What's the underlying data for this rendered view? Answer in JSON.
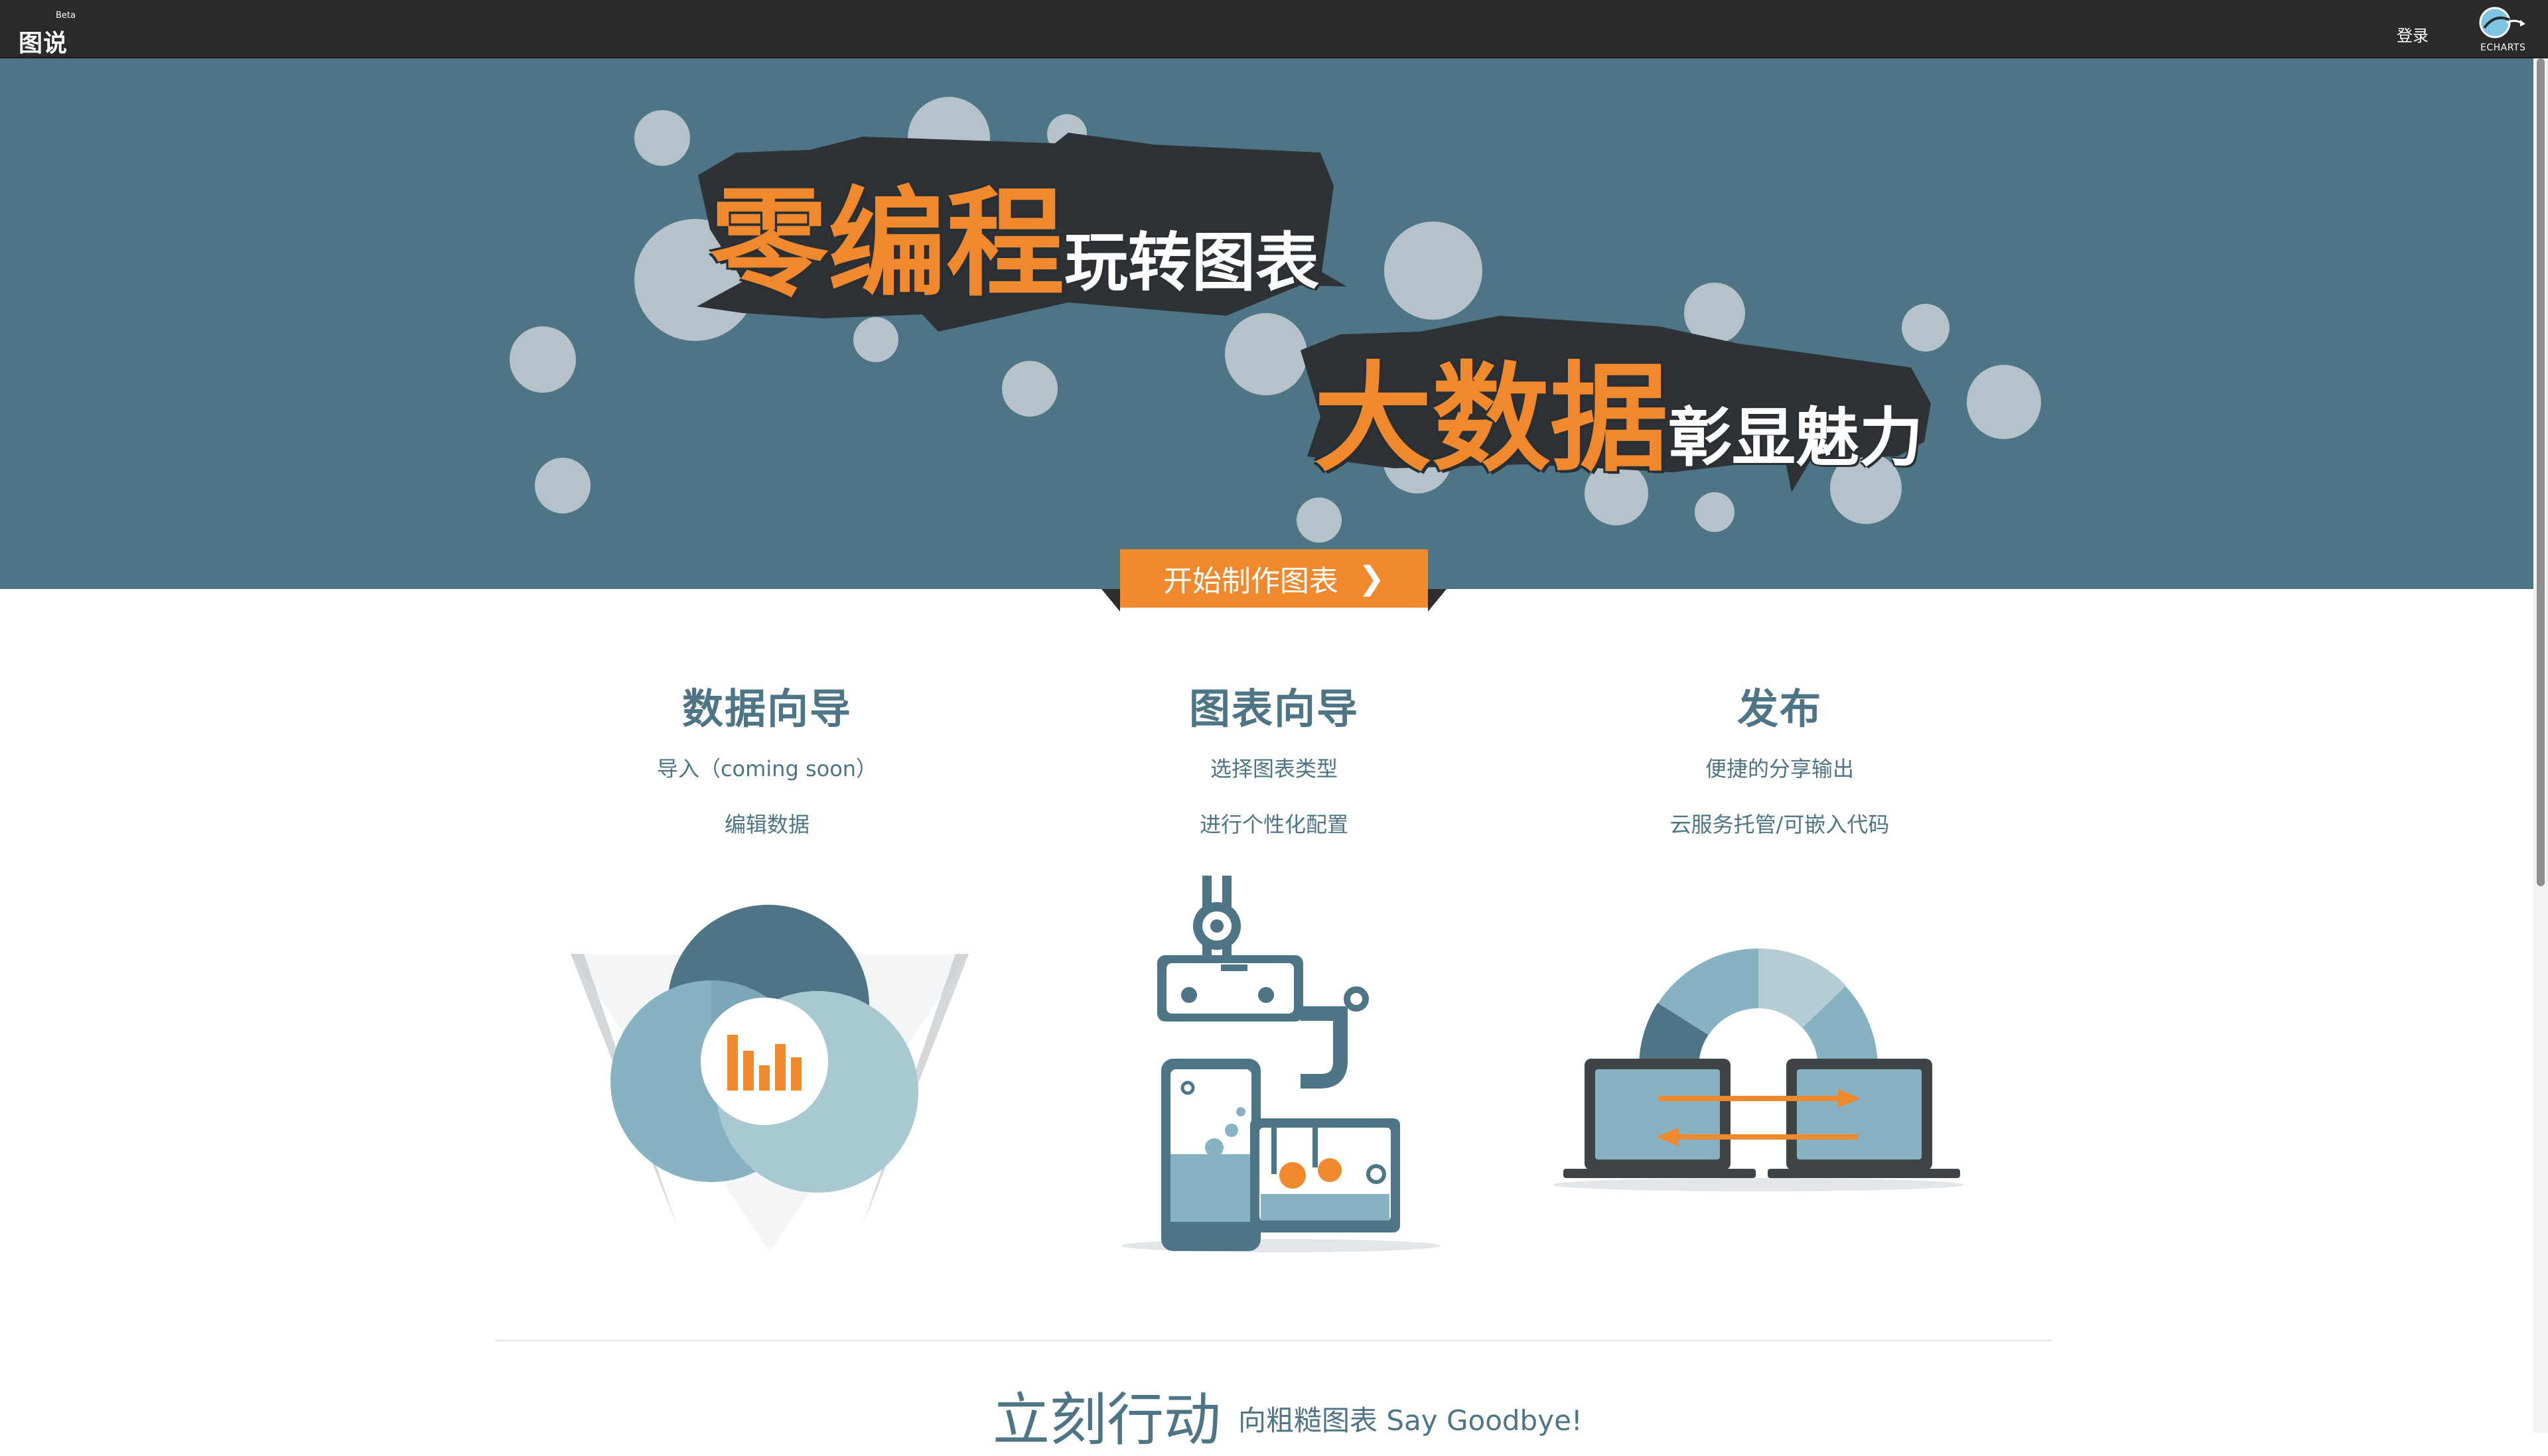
{
  "navbar": {
    "brand_badge": "Beta",
    "brand_name": "图说",
    "login_label": "登录",
    "logo_label": "ECHARTS"
  },
  "hero": {
    "headline1_big": "零编程",
    "headline1_small": "玩转图表",
    "headline2_big": "大数据",
    "headline2_small": "彰显魅力",
    "cta_label": "开始制作图表"
  },
  "features": [
    {
      "title": "数据向导",
      "lines": [
        "导入（coming soon）",
        "编辑数据"
      ]
    },
    {
      "title": "图表向导",
      "lines": [
        "选择图表类型",
        "进行个性化配置"
      ]
    },
    {
      "title": "发布",
      "lines": [
        "便捷的分享输出",
        "云服务托管/可嵌入代码"
      ]
    }
  ],
  "bottom": {
    "title": "立刻行动",
    "subtitle": "向粗糙图表 Say Goodbye!"
  },
  "colors": {
    "navbar_bg": "#2a2a2a",
    "hero_bg": "#4d7586",
    "accent": "#f0892d",
    "text_primary": "#4d7586"
  }
}
